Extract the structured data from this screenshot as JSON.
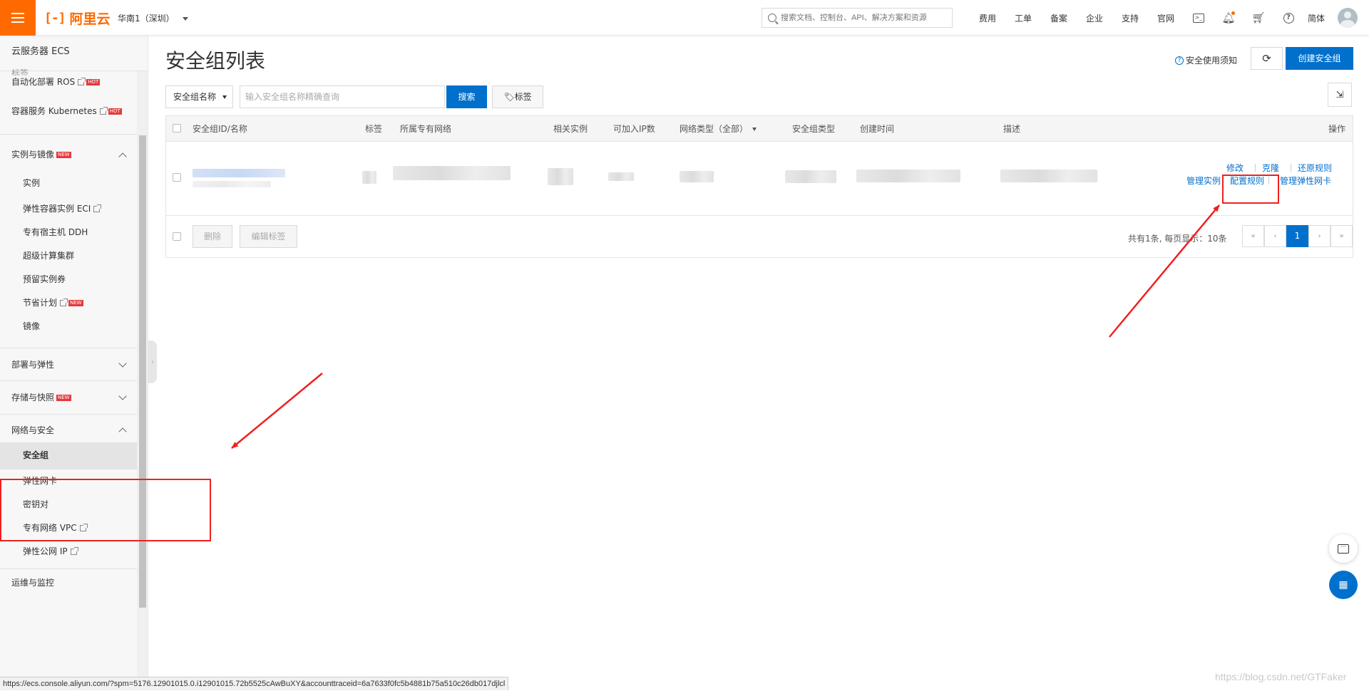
{
  "header": {
    "logo_text": "阿里云",
    "region": "华南1（深圳）",
    "search_placeholder": "搜索文档、控制台、API、解决方案和资源",
    "nav": [
      "费用",
      "工单",
      "备案",
      "企业",
      "支持",
      "官网"
    ],
    "lang": "简体"
  },
  "sidebar": {
    "title": "云服务器 ECS",
    "partial_top": "标签",
    "links": [
      {
        "label": "自动化部署 ROS",
        "badge": "HOT"
      },
      {
        "label": "容器服务 Kubernetes",
        "badge": "HOT"
      }
    ],
    "groups": {
      "instances": {
        "label": "实例与镜像",
        "badge": "NEW",
        "items": [
          "实例",
          "弹性容器实例 ECI",
          "专有宿主机 DDH",
          "超级计算集群",
          "预留实例券",
          "节省计划",
          "镜像"
        ]
      },
      "deploy": {
        "label": "部署与弹性"
      },
      "storage": {
        "label": "存储与快照",
        "badge": "NEW"
      },
      "network": {
        "label": "网络与安全",
        "items": [
          "安全组",
          "弹性网卡",
          "密钥对",
          "专有网络 VPC",
          "弹性公网 IP"
        ]
      },
      "ops": {
        "label": "运维与监控"
      }
    },
    "saving_badge": "NEW"
  },
  "main": {
    "title": "安全组列表",
    "notice": "安全使用须知",
    "create_button": "创建安全组",
    "filter": {
      "select": "安全组名称",
      "placeholder": "输入安全组名称精确查询",
      "search_button": "搜索",
      "tag_button": "标签"
    },
    "columns": [
      "安全组ID/名称",
      "标签",
      "所属专有网络",
      "相关实例",
      "可加入IP数",
      "网络类型（全部）",
      "安全组类型",
      "创建时间",
      "描述",
      "操作"
    ],
    "row_actions": {
      "edit": "修改",
      "clone": "克隆",
      "restore": "还原规则",
      "manage_instances": "管理实例",
      "config_rules": "配置规则",
      "manage_eni": "管理弹性网卡"
    },
    "footer": {
      "delete": "删除",
      "edit_tags": "编辑标签",
      "summary": "共有1条, 每页显示：10条",
      "pager": {
        "first": "«",
        "prev": "‹",
        "current": "1",
        "next": "›",
        "last": "»"
      }
    }
  },
  "statusbar": {
    "url": "https://ecs.console.aliyun.com/?spm=5176.12901015.0.i12901015.72b5525cAwBuXY&accounttraceid=6a7633f0fc5b4881b75a510c26db017djlcl"
  },
  "watermark": "https://blog.csdn.net/GTFaker",
  "colors": {
    "accent": "#ff6a00",
    "primary": "#0070cc",
    "annotation": "#f02020"
  }
}
